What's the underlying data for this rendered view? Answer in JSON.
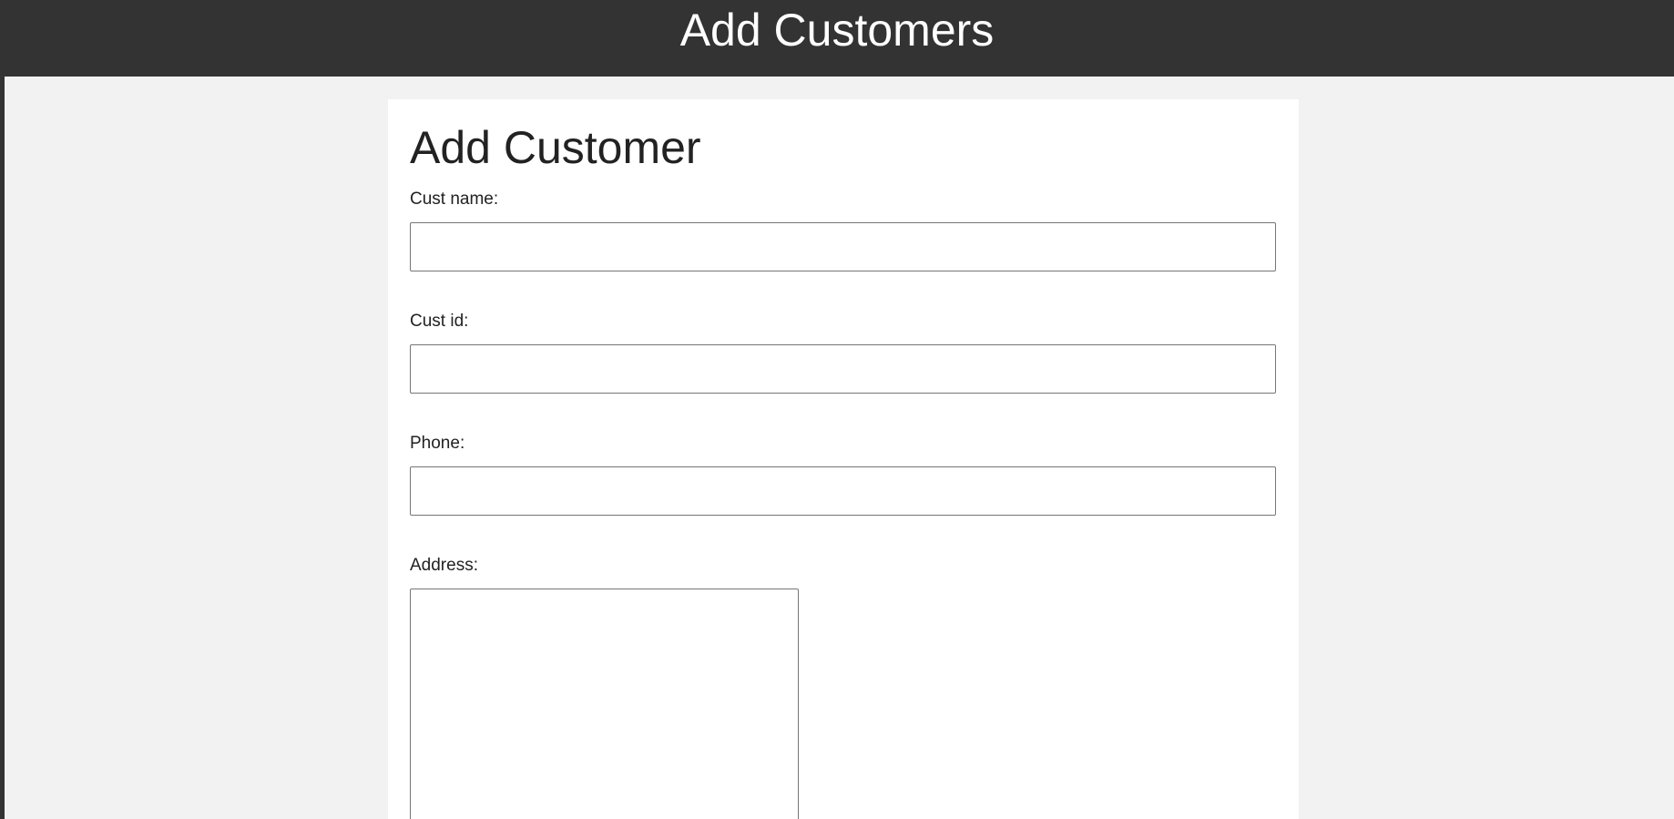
{
  "header": {
    "title": "Add Customers"
  },
  "form": {
    "title": "Add Customer",
    "fields": {
      "cust_name": {
        "label": "Cust name:",
        "value": "",
        "placeholder": ""
      },
      "cust_id": {
        "label": "Cust id:",
        "value": "",
        "placeholder": ""
      },
      "phone": {
        "label": "Phone:",
        "value": "",
        "placeholder": ""
      },
      "address": {
        "label": "Address:",
        "value": "",
        "placeholder": ""
      }
    }
  },
  "colors": {
    "header_bg": "#333333",
    "header_text": "#ffffff",
    "page_bg": "#f2f2f2",
    "card_bg": "#ffffff"
  }
}
